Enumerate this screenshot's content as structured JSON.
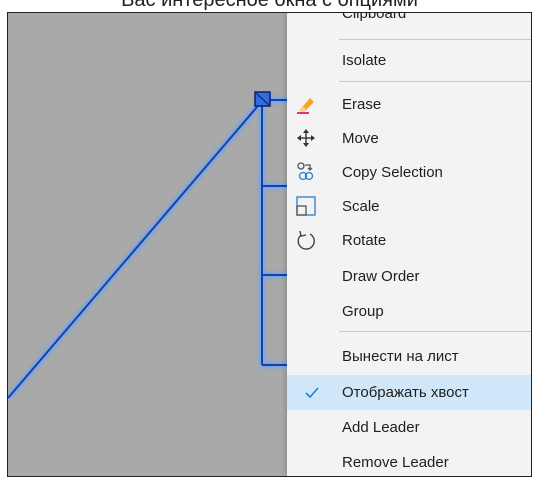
{
  "caption": {
    "text": "Вас интересное окна с опциями"
  },
  "menu": {
    "items": [
      {
        "id": "clipboard",
        "label": "Clipboard",
        "icon": ""
      },
      {
        "id": "isolate",
        "label": "Isolate",
        "icon": ""
      },
      {
        "id": "erase",
        "label": "Erase",
        "icon": "eraser-icon"
      },
      {
        "id": "move",
        "label": "Move",
        "icon": "move-arrows-icon"
      },
      {
        "id": "copy-selection",
        "label": "Copy Selection",
        "icon": "copy-selection-icon"
      },
      {
        "id": "scale",
        "label": "Scale",
        "icon": "scale-icon"
      },
      {
        "id": "rotate",
        "label": "Rotate",
        "icon": "rotate-icon"
      },
      {
        "id": "draw-order",
        "label": "Draw Order",
        "icon": ""
      },
      {
        "id": "group",
        "label": "Group",
        "icon": ""
      },
      {
        "id": "move-to-sheet",
        "label": "Вынести на лист",
        "icon": ""
      },
      {
        "id": "show-tail",
        "label": "Отображать хвост",
        "icon": "checkmark-icon",
        "checked": true
      },
      {
        "id": "add-leader",
        "label": "Add Leader",
        "icon": ""
      },
      {
        "id": "remove-leader",
        "label": "Remove Leader",
        "icon": ""
      }
    ]
  },
  "colors": {
    "canvas_background": "#a9a9a9",
    "selected_line": "#1a3db5",
    "selection_glow": "#6aa8e8",
    "menu_background": "#f3f3f3",
    "highlight": "#cfe7f9",
    "checkmark": "#2b7cd3"
  }
}
